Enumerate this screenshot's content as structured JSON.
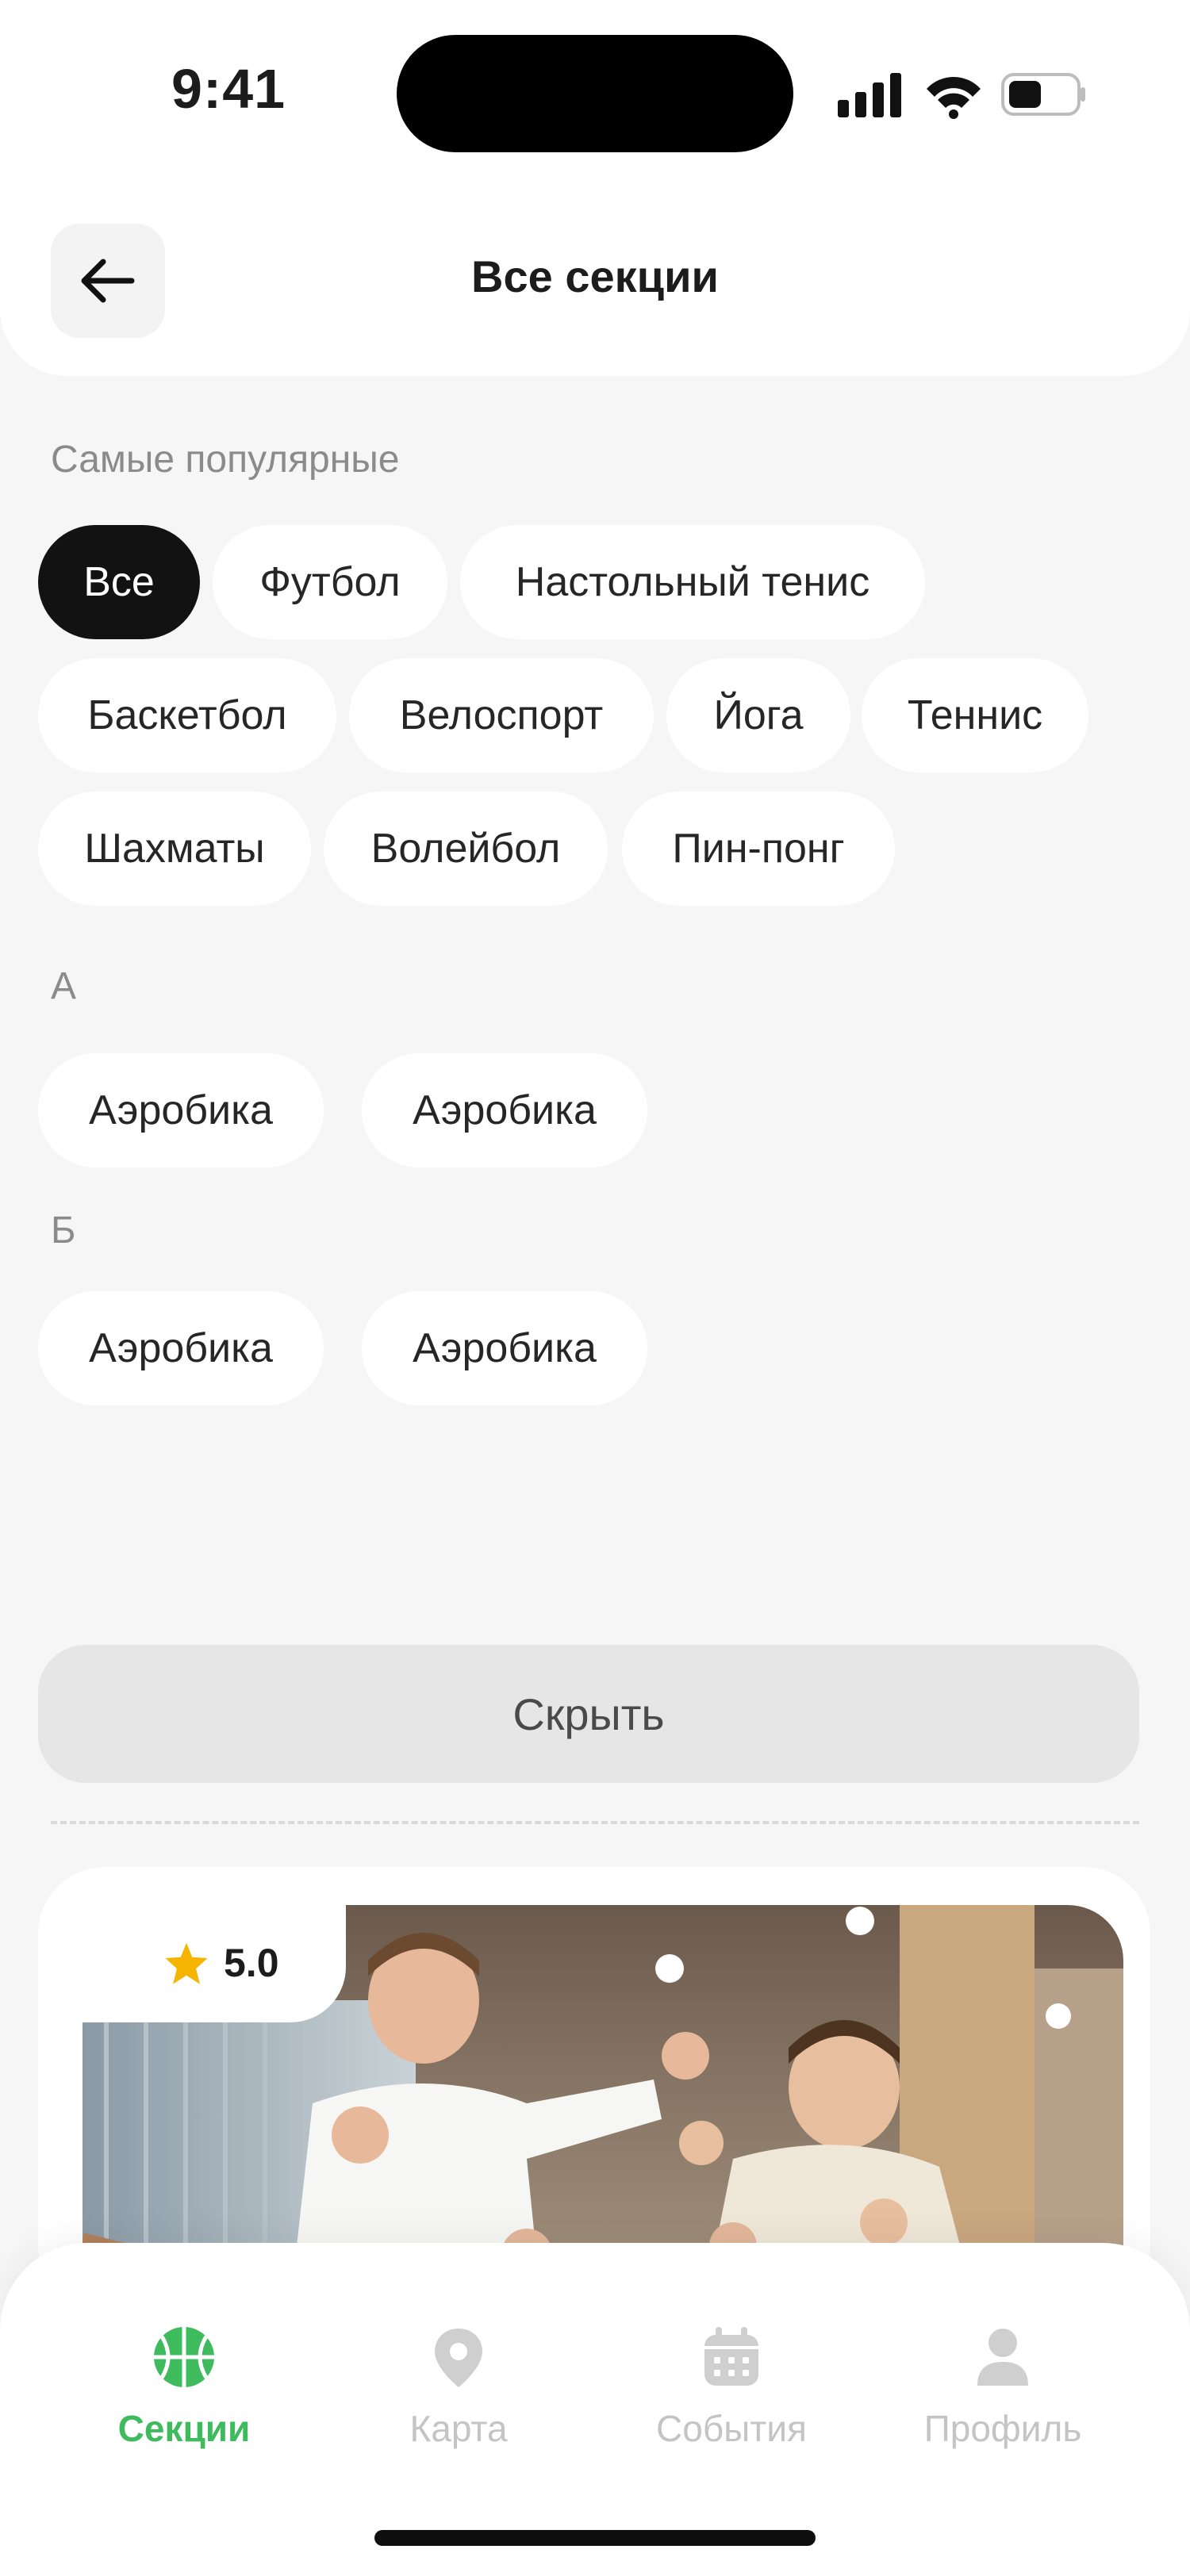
{
  "status": {
    "time": "9:41"
  },
  "header": {
    "title": "Все секции"
  },
  "popular": {
    "label": "Самые популярные",
    "chips": [
      "Все",
      "Футбол",
      "Настольный тенис",
      "Баскетбол",
      "Велоспорт",
      "Йога",
      "Теннис",
      "Шахматы",
      "Волейбол",
      "Пин-понг"
    ],
    "active": "Все"
  },
  "groups": [
    {
      "letter": "А",
      "items": [
        "Аэробика",
        "Аэробика"
      ]
    },
    {
      "letter": "Б",
      "items": [
        "Аэробика",
        "Аэробика"
      ]
    }
  ],
  "hide_button": "Скрыть",
  "card": {
    "rating": "5.0"
  },
  "tabs": [
    {
      "label": "Секции",
      "icon": "basketball-icon",
      "active": true
    },
    {
      "label": "Карта",
      "icon": "map-pin-icon",
      "active": false
    },
    {
      "label": "События",
      "icon": "calendar-icon",
      "active": false
    },
    {
      "label": "Профиль",
      "icon": "profile-icon",
      "active": false
    }
  ],
  "colors": {
    "accent": "#3dbb5d",
    "active_chip": "#121212",
    "rating_star": "#f5b400"
  }
}
